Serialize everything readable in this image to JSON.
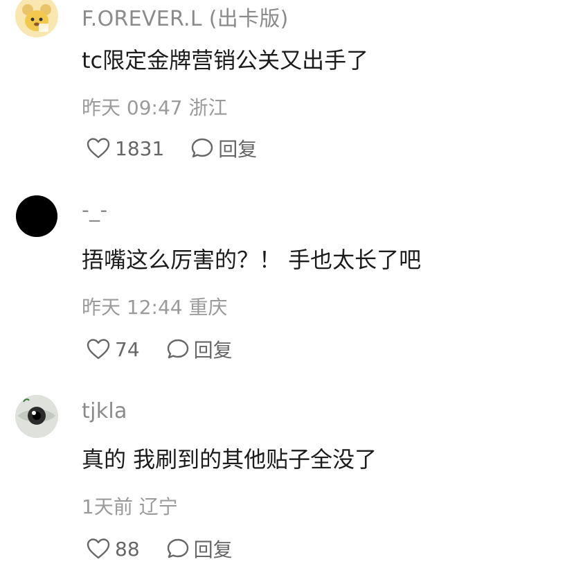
{
  "comments": [
    {
      "username": "F.OREVER.L (出卡版)",
      "text": "tc限定金牌营销公关又出手了",
      "meta": "昨天 09:47 浙江",
      "likes": "1831",
      "reply_label": "回复",
      "avatar": "cartoon-bear-avatar"
    },
    {
      "username": "-_-",
      "text": "捂嘴这么厉害的？！ 手也太长了吧",
      "meta": "昨天 12:44 重庆",
      "likes": "74",
      "reply_label": "回复",
      "avatar": "black-circle-avatar"
    },
    {
      "username": "tjkla",
      "text": "真的 我刷到的其他贴子全没了",
      "meta": "1天前 辽宁",
      "likes": "88",
      "reply_label": "回复",
      "avatar": "eye-avatar"
    }
  ],
  "icons": {
    "like": "heart-outline-icon",
    "reply": "speech-bubble-icon"
  },
  "colors": {
    "username": "#8a8a8a",
    "text": "#1b1b1b",
    "meta": "#9a9a9a",
    "action": "#666666"
  }
}
